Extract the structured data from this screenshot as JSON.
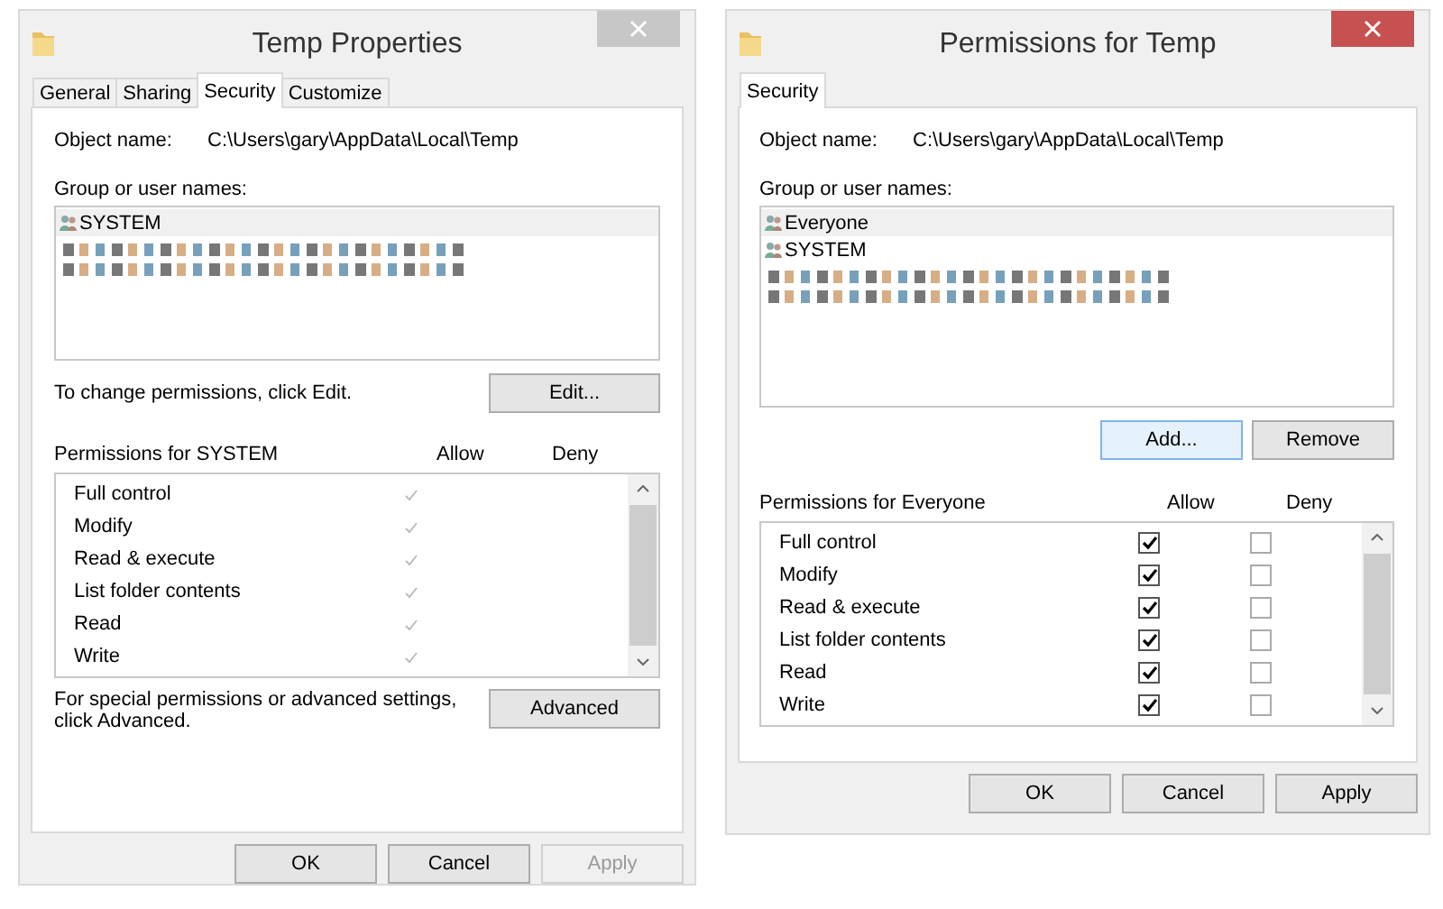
{
  "dialogs": [
    {
      "title": "Temp Properties",
      "active": false,
      "tabs": [
        {
          "label": "General",
          "selected": false
        },
        {
          "label": "Sharing",
          "selected": false
        },
        {
          "label": "Security",
          "selected": true
        },
        {
          "label": "Customize",
          "selected": false
        }
      ],
      "object_name_label": "Object name:",
      "object_name": "C:\\Users\\gary\\AppData\\Local\\Temp",
      "group_label": "Group or user names:",
      "users": [
        {
          "kind": "user",
          "name": "SYSTEM",
          "selected": true
        },
        {
          "kind": "redacted",
          "selected": false
        },
        {
          "kind": "redacted",
          "selected": false
        }
      ],
      "hint": "To change permissions, click Edit.",
      "side_buttons": [
        {
          "label": "Edit...",
          "focused": false
        }
      ],
      "permissions_label": "Permissions for SYSTEM",
      "allow_header": "Allow",
      "deny_header": "Deny",
      "disabled": true,
      "permissions": [
        {
          "name": "Full control",
          "allow": true,
          "deny": false
        },
        {
          "name": "Modify",
          "allow": true,
          "deny": false
        },
        {
          "name": "Read & execute",
          "allow": true,
          "deny": false
        },
        {
          "name": "List folder contents",
          "allow": true,
          "deny": false
        },
        {
          "name": "Read",
          "allow": true,
          "deny": false
        },
        {
          "name": "Write",
          "allow": true,
          "deny": false
        }
      ],
      "advanced_text": "For special permissions or advanced settings, click Advanced.",
      "advanced_button": "Advanced",
      "footer_buttons": [
        {
          "label": "OK",
          "disabled": false
        },
        {
          "label": "Cancel",
          "disabled": false
        },
        {
          "label": "Apply",
          "disabled": true
        }
      ]
    },
    {
      "title": "Permissions for Temp",
      "active": true,
      "tabs": [
        {
          "label": "Security",
          "selected": true
        }
      ],
      "object_name_label": "Object name:",
      "object_name": "C:\\Users\\gary\\AppData\\Local\\Temp",
      "group_label": "Group or user names:",
      "users": [
        {
          "kind": "user",
          "name": "Everyone",
          "selected": true
        },
        {
          "kind": "user",
          "name": "SYSTEM",
          "selected": false
        },
        {
          "kind": "redacted",
          "selected": false
        },
        {
          "kind": "redacted",
          "selected": false
        }
      ],
      "side_buttons": [
        {
          "label": "Add...",
          "focused": true
        },
        {
          "label": "Remove",
          "focused": false
        }
      ],
      "permissions_label": "Permissions for Everyone",
      "allow_header": "Allow",
      "deny_header": "Deny",
      "disabled": false,
      "permissions": [
        {
          "name": "Full control",
          "allow": true,
          "deny": false
        },
        {
          "name": "Modify",
          "allow": true,
          "deny": false
        },
        {
          "name": "Read & execute",
          "allow": true,
          "deny": false
        },
        {
          "name": "List folder contents",
          "allow": true,
          "deny": false
        },
        {
          "name": "Read",
          "allow": true,
          "deny": false
        },
        {
          "name": "Write",
          "allow": true,
          "deny": false
        }
      ],
      "footer_buttons": [
        {
          "label": "OK",
          "disabled": false
        },
        {
          "label": "Cancel",
          "disabled": false
        },
        {
          "label": "Apply",
          "disabled": false
        }
      ]
    }
  ]
}
